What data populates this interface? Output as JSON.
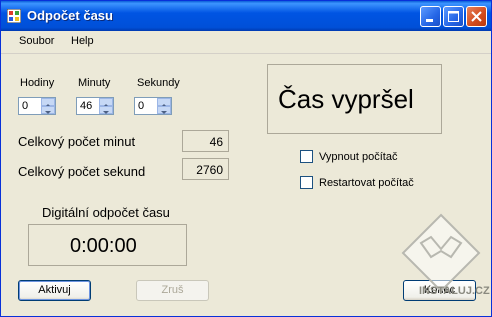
{
  "window": {
    "title": "Odpočet času"
  },
  "menu": {
    "file": "Soubor",
    "help": "Help"
  },
  "time_inputs": {
    "hours": {
      "label": "Hodiny",
      "value": "0"
    },
    "minutes": {
      "label": "Minuty",
      "value": "46"
    },
    "seconds": {
      "label": "Sekundy",
      "value": "0"
    }
  },
  "totals": {
    "minutes_label": "Celkový počet minut",
    "minutes_value": "46",
    "seconds_label": "Celkový počet sekund",
    "seconds_value": "2760"
  },
  "status": {
    "message": "Čas vypršel"
  },
  "options": {
    "shutdown": {
      "label": "Vypnout počítač",
      "checked": false
    },
    "restart": {
      "label": "Restartovat počítač",
      "checked": false
    }
  },
  "countdown": {
    "label": "Digitální odpočet času",
    "value": "0:00:00"
  },
  "buttons": {
    "activate": "Aktivuj",
    "cancel": "Zruš",
    "end": "Konec"
  },
  "watermark": {
    "text": "INSTALUJ.CZ"
  },
  "colors": {
    "titlebar": "#0054e3",
    "background": "#ece9d8",
    "disabled_text": "#aca899"
  }
}
